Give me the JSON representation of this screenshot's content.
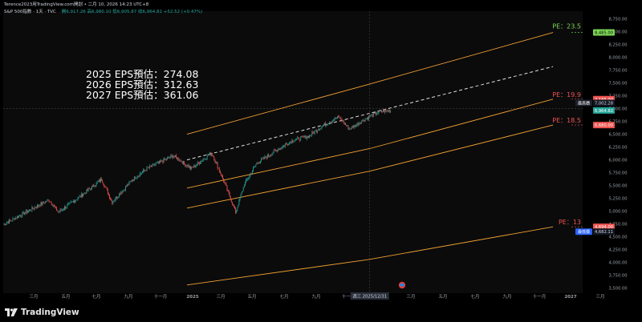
{
  "header": {
    "title": "Terence2023用TradingView.com開創 • 二月 10, 2026 14:23 UTC+8",
    "symbol_line": "S&P 500指數 · 1天 · TVC",
    "ohlc": "開6,917.26  高6,980.10  低6,905.87  收6,964.82  +52.52 (+0.47%)"
  },
  "annotations": {
    "eps_2025": "2025 EPS預估：274.08",
    "eps_2026": "2026 EPS預估：312.63",
    "eps_2027": "2027 EPS預估：361.06",
    "pe_23_5": "PE：23.5",
    "pe_19_9": "PE：19.9",
    "pe_18_5": "PE：18.5",
    "pe_13": "PE：13"
  },
  "axis_badges": {
    "pe23_value": "8,485.00",
    "pe19_value": "7,185.00",
    "high_label": "最高價",
    "high_value": "7,002.28",
    "last_value": "6,964.82",
    "pe18_value": "6,680.00",
    "pe13_value": "4,694.00",
    "low_label": "最低價",
    "low_value": "4,682.11"
  },
  "crosshair_date": "週三 2025/12/31",
  "brand": "TradingView",
  "colors": {
    "background": "#0b0b0c",
    "pe_high": "#7ed957",
    "pe_low": "#ef5350",
    "band": "#f0a030",
    "trend": "#e0e0e0",
    "up": "#26a69a",
    "down": "#ef5350",
    "last_price": "#26a69a",
    "low_badge": "#2962ff"
  },
  "chart_data": {
    "type": "line",
    "title": "S&P 500指數 · 1天 · TVC",
    "xlabel": "",
    "ylabel": "",
    "x_ticks": [
      "三月",
      "五月",
      "七月",
      "九月",
      "十一月",
      "2025",
      "三月",
      "五月",
      "七月",
      "九月",
      "十一月",
      "三月",
      "五月",
      "七月",
      "九月",
      "十一月",
      "2027",
      "三月"
    ],
    "y_ticks": [
      3500,
      3750,
      4000,
      4250,
      4500,
      4750,
      5000,
      5250,
      5500,
      5750,
      6000,
      6250,
      6500,
      6750,
      7000,
      7250,
      7500,
      7750,
      8000,
      8250,
      8500,
      8750
    ],
    "ylim": [
      3400,
      8900
    ],
    "grid": false,
    "price_series": {
      "name": "S&P 500",
      "points": [
        [
          "2024-01-01",
          4740
        ],
        [
          "2024-02-15",
          4980
        ],
        [
          "2024-04-01",
          5220
        ],
        [
          "2024-04-20",
          4980
        ],
        [
          "2024-06-01",
          5280
        ],
        [
          "2024-07-15",
          5620
        ],
        [
          "2024-08-05",
          5180
        ],
        [
          "2024-09-15",
          5620
        ],
        [
          "2024-10-15",
          5840
        ],
        [
          "2024-12-05",
          6080
        ],
        [
          "2025-01-10",
          5830
        ],
        [
          "2025-02-19",
          6140
        ],
        [
          "2025-03-15",
          5600
        ],
        [
          "2025-04-08",
          4980
        ],
        [
          "2025-04-25",
          5520
        ],
        [
          "2025-05-20",
          5940
        ],
        [
          "2025-06-30",
          6200
        ],
        [
          "2025-07-31",
          6380
        ],
        [
          "2025-08-31",
          6460
        ],
        [
          "2025-09-30",
          6680
        ],
        [
          "2025-10-31",
          6840
        ],
        [
          "2025-11-20",
          6600
        ],
        [
          "2025-12-31",
          6850
        ],
        [
          "2026-01-20",
          6940
        ],
        [
          "2026-02-10",
          6964.82
        ]
      ]
    },
    "pe_bands": [
      {
        "name": "PE：23.5",
        "points": [
          [
            "2025-01-01",
            6500
          ],
          [
            "2025-12-31",
            7480
          ],
          [
            "2026-12-31",
            8485
          ]
        ]
      },
      {
        "name": "PE：19.9",
        "points": [
          [
            "2025-01-01",
            5450
          ],
          [
            "2025-12-31",
            6220
          ],
          [
            "2026-12-31",
            7185
          ]
        ]
      },
      {
        "name": "PE：18.5",
        "points": [
          [
            "2025-01-01",
            5060
          ],
          [
            "2025-12-31",
            5780
          ],
          [
            "2026-12-31",
            6680
          ]
        ]
      },
      {
        "name": "PE：13",
        "points": [
          [
            "2025-01-01",
            3560
          ],
          [
            "2025-12-31",
            4060
          ],
          [
            "2026-12-31",
            4694
          ]
        ]
      }
    ],
    "trend_line": {
      "points": [
        [
          "2025-01-01",
          6000
        ],
        [
          "2026-12-31",
          7820
        ]
      ]
    },
    "crosshair_price": 7002
  }
}
